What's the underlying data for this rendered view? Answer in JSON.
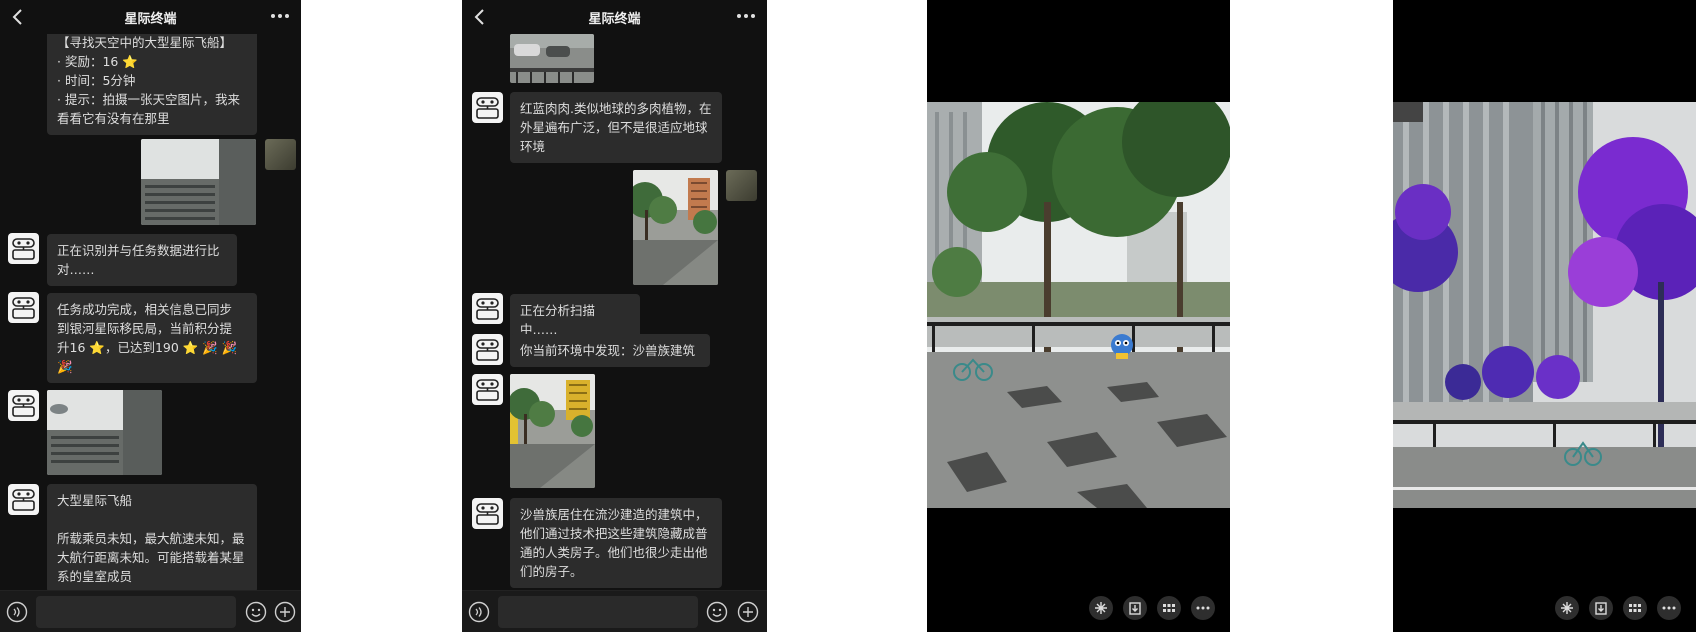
{
  "phone1": {
    "title": "星际终端",
    "messages": [
      {
        "type": "bot_text",
        "text": "【寻找天空中的大型星际飞船】\n· 奖励：16 ⭐\n· 时间：5分钟\n· 提示：拍摄一张天空图片，我来\n看看它有没有在那里"
      },
      {
        "type": "user_photo",
        "content": "sky-buildings-photo"
      },
      {
        "type": "bot_text",
        "text": "正在识别并与任务数据进行比\n对……"
      },
      {
        "type": "bot_text",
        "text": "任务成功完成，相关信息已同步\n到银河星际移民局，当前积分提\n升16 ⭐，已达到190 ⭐ 🎉 🎉\n🎉"
      },
      {
        "type": "bot_photo",
        "content": "sky-with-spaceship-photo"
      },
      {
        "type": "bot_text",
        "text": "大型星际飞船\n\n所载乘员未知，最大航速未知，最\n大航行距离未知。可能搭载着某星\n系的皇室成员"
      }
    ]
  },
  "phone2": {
    "title": "星际终端",
    "messages": [
      {
        "type": "bot_photo",
        "content": "street-cars-photo"
      },
      {
        "type": "bot_text",
        "text": "红蓝肉肉.类似地球的多肉植物，在\n外星遍布广泛，但不是很适应地球\n环境"
      },
      {
        "type": "user_photo",
        "content": "street-trees-photo"
      },
      {
        "type": "bot_text",
        "text": "正在分析扫描中……"
      },
      {
        "type": "bot_text",
        "text": "你当前环境中发现：沙兽族建筑"
      },
      {
        "type": "bot_photo",
        "content": "street-yellow-building-photo"
      },
      {
        "type": "bot_text",
        "text": "沙兽族居住在流沙建造的建筑中，\n他们通过技术把这些建筑隐藏成普\n通的人类房子。他们也很少走出他\n们的房子。"
      }
    ]
  },
  "phone3": {
    "scene": "street-with-green-trees-and-creature",
    "toolbar": [
      "sparkle-icon",
      "download-icon",
      "grid-icon",
      "more-icon"
    ]
  },
  "phone4": {
    "scene": "street-with-purple-trees-and-towers",
    "toolbar": [
      "sparkle-icon",
      "download-icon",
      "grid-icon",
      "more-icon"
    ]
  },
  "colors": {
    "chat_bg": "#111111",
    "bubble_bg": "#2c2c2c",
    "text": "#dedede",
    "purple_tree": "#7a2bd0"
  }
}
